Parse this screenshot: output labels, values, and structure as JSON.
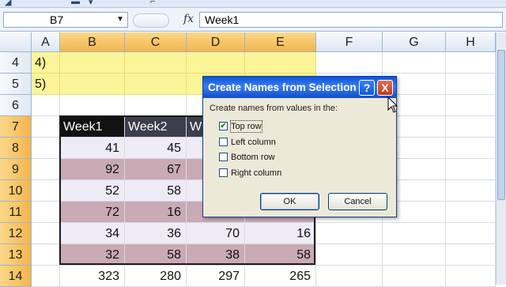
{
  "name_box": "B7",
  "formula_icon": "fx",
  "formula_value": "Week1",
  "columns": [
    "A",
    "B",
    "C",
    "D",
    "E",
    "F",
    "G",
    "H"
  ],
  "rows": [
    {
      "num": "4",
      "cells": [
        "4)",
        "",
        "",
        "",
        ""
      ]
    },
    {
      "num": "5",
      "cells": [
        "5)",
        "",
        "",
        "",
        ""
      ]
    },
    {
      "num": "6",
      "cells": [
        "",
        "",
        "",
        "",
        ""
      ]
    },
    {
      "num": "7",
      "cells": [
        "",
        "Week1",
        "Week2",
        "W",
        ""
      ]
    },
    {
      "num": "8",
      "cells": [
        "",
        "41",
        "45",
        "",
        ""
      ]
    },
    {
      "num": "9",
      "cells": [
        "",
        "92",
        "67",
        "",
        ""
      ]
    },
    {
      "num": "10",
      "cells": [
        "",
        "52",
        "58",
        "",
        ""
      ]
    },
    {
      "num": "11",
      "cells": [
        "",
        "72",
        "16",
        "",
        ""
      ]
    },
    {
      "num": "12",
      "cells": [
        "",
        "34",
        "36",
        "70",
        "16"
      ]
    },
    {
      "num": "13",
      "cells": [
        "",
        "32",
        "58",
        "38",
        "58"
      ]
    },
    {
      "num": "14",
      "cells": [
        "",
        "323",
        "280",
        "297",
        "265"
      ]
    }
  ],
  "dialog": {
    "title": "Create Names from Selection",
    "help": "?",
    "close": "X",
    "prompt": "Create names from values in the:",
    "options": [
      {
        "label": "Top row",
        "checked": true
      },
      {
        "label": "Left column",
        "checked": false
      },
      {
        "label": "Bottom row",
        "checked": false
      },
      {
        "label": "Right column",
        "checked": false
      }
    ],
    "ok": "OK",
    "cancel": "Cancel"
  },
  "colors": {
    "header_fill": "#121212",
    "band_light": "#eeeaf6",
    "band_dark": "#c9aab5",
    "yellow": "#fbf498",
    "title_bar": "#0a55d8"
  }
}
